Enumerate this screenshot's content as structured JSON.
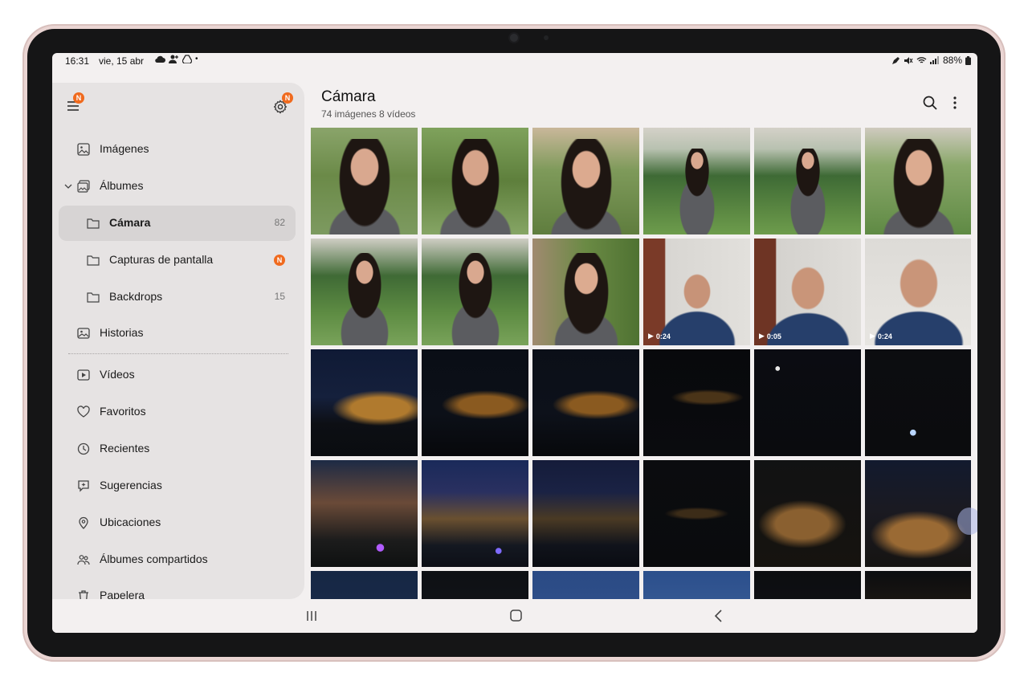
{
  "status": {
    "time": "16:31",
    "date": "vie, 15 abr",
    "battery": "88%"
  },
  "sidebar": {
    "menu_badge": "N",
    "settings_badge": "N",
    "items": [
      {
        "label": "Imágenes",
        "icon": "image-icon"
      },
      {
        "label": "Álbumes",
        "icon": "albums-icon"
      },
      {
        "label": "Cámara",
        "icon": "folder-icon",
        "count": "82"
      },
      {
        "label": "Capturas de pantalla",
        "icon": "folder-icon",
        "badge": "N"
      },
      {
        "label": "Backdrops",
        "icon": "folder-icon",
        "count": "15"
      },
      {
        "label": "Historias",
        "icon": "stories-icon"
      },
      {
        "label": "Vídeos",
        "icon": "video-icon"
      },
      {
        "label": "Favoritos",
        "icon": "heart-icon"
      },
      {
        "label": "Recientes",
        "icon": "clock-icon"
      },
      {
        "label": "Sugerencias",
        "icon": "suggestions-icon"
      },
      {
        "label": "Ubicaciones",
        "icon": "location-icon"
      },
      {
        "label": "Álbumes compartidos",
        "icon": "shared-albums-icon"
      },
      {
        "label": "Papelera",
        "icon": "trash-icon"
      }
    ]
  },
  "main": {
    "title": "Cámara",
    "subtitle": "74 imágenes 8 vídeos"
  },
  "videos": {
    "v1": "0:24",
    "v2": "0:05",
    "v3": "0:24"
  },
  "colors": {
    "accent_badge": "#f06a1e",
    "sidebar_bg": "#e6e3e3",
    "screen_bg": "#f3f0f0"
  }
}
